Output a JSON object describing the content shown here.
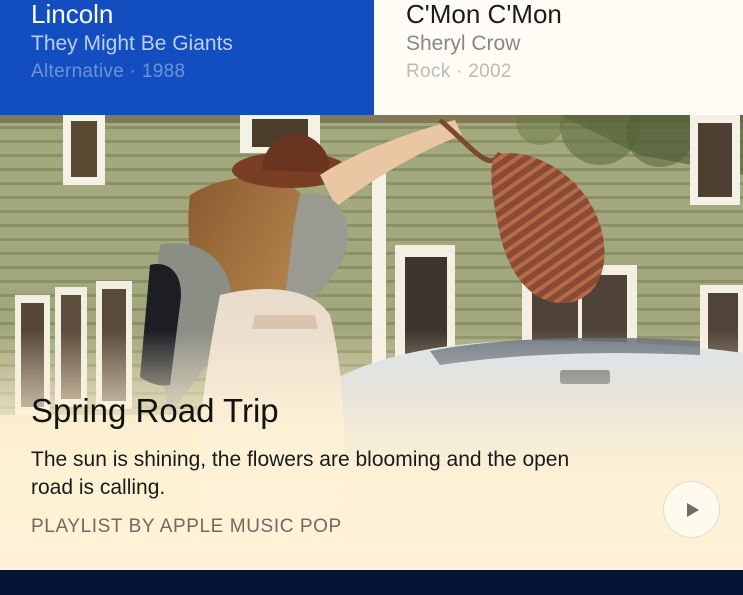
{
  "albums": [
    {
      "title": "Lincoln",
      "artist": "They Might Be Giants",
      "genre": "Alternative",
      "year": "1988",
      "meta": "Alternative · 1988",
      "background": "#134ec0"
    },
    {
      "title": "C'Mon C'Mon",
      "artist": "Sheryl Crow",
      "genre": "Rock",
      "year": "2002",
      "meta": "Rock · 2002",
      "background": "#fffcf5"
    }
  ],
  "playlist": {
    "title": "Spring Road Trip",
    "description": "The sun is shining, the flowers are blooming and the open road is calling.",
    "curator": "PLAYLIST BY APPLE MUSIC POP",
    "play_icon": "play-icon",
    "fade_color": "#fff2d6"
  },
  "next_card": {
    "background": "#041438"
  }
}
